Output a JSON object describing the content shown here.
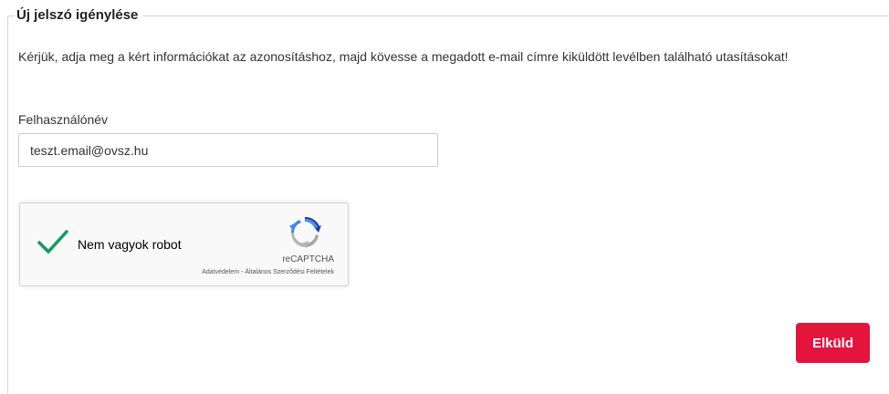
{
  "form": {
    "legend": "Új jelszó igénylése",
    "intro": "Kérjük, adja meg a kért információkat az azonosításhoz, majd kövesse a megadott e-mail címre kiküldött levélben található utasításokat!",
    "username_label": "Felhasználónév",
    "username_value": "teszt.email@ovsz.hu",
    "submit_label": "Elküld"
  },
  "recaptcha": {
    "label": "Nem vagyok robot",
    "checked": true,
    "brand": "reCAPTCHA",
    "privacy_link": "Adatvédelem",
    "separator": "-",
    "terms_link": "Általános Szerződési Feltételek"
  },
  "colors": {
    "submit_bg": "#e4143c",
    "check": "#0f9d58",
    "border": "#d6d6d6"
  },
  "icons": {
    "check": "checkmark-icon",
    "recaptcha": "recaptcha-logo-icon"
  }
}
